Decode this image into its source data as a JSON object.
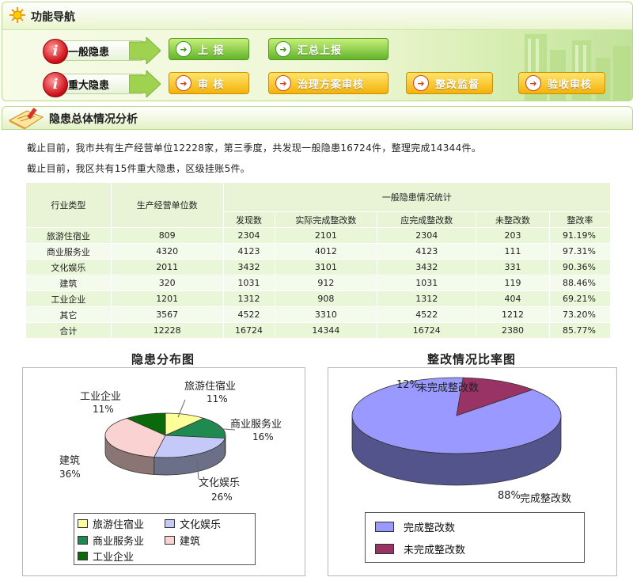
{
  "nav": {
    "title": "功能导航",
    "rows": [
      {
        "label": "一般隐患",
        "buttons": [
          "上 报",
          "汇总上报"
        ]
      },
      {
        "label": "重大隐患",
        "buttons": [
          "审 核",
          "治理方案审核",
          "整改监督",
          "验收审核"
        ]
      }
    ],
    "colors": {
      "green_button": "#62b42b",
      "orange_button": "#f3b20c",
      "info_icon": "#d0121b"
    }
  },
  "analysis": {
    "title": "隐患总体情况分析",
    "summary_1": "截止目前，我市共有生产经营单位12228家，第三季度，共发现一般隐患16724件，整理完成14344件。",
    "summary_2": "截止目前，我区共有15件重大隐患，区级挂账5件。"
  },
  "table": {
    "header_industry": "行业类型",
    "header_units": "生产经营单位数",
    "header_group": "一般隐患情况统计",
    "sub_headers": [
      "发现数",
      "实际完成整改数",
      "应完成整改数",
      "未整改数",
      "整改率"
    ],
    "rows": [
      [
        "旅游住宿业",
        "809",
        "2304",
        "2101",
        "2304",
        "203",
        "91.19%"
      ],
      [
        "商业服务业",
        "4320",
        "4123",
        "4012",
        "4123",
        "111",
        "97.31%"
      ],
      [
        "文化娱乐",
        "2011",
        "3432",
        "3101",
        "3432",
        "331",
        "90.36%"
      ],
      [
        "建筑",
        "320",
        "1031",
        "912",
        "1031",
        "119",
        "88.46%"
      ],
      [
        "工业企业",
        "1201",
        "1312",
        "908",
        "1312",
        "404",
        "69.21%"
      ],
      [
        "其它",
        "3567",
        "4522",
        "3310",
        "4522",
        "1212",
        "73.20%"
      ],
      [
        "合计",
        "12228",
        "16724",
        "14344",
        "16724",
        "2380",
        "85.77%"
      ]
    ]
  },
  "chart_data": [
    {
      "type": "pie",
      "title": "隐患分布图",
      "slices": [
        {
          "label": "旅游住宿业",
          "value": 11,
          "pct_label": "11%",
          "color": "#ffff99"
        },
        {
          "label": "商业服务业",
          "value": 16,
          "pct_label": "16%",
          "color": "#1f8a50"
        },
        {
          "label": "文化娱乐",
          "value": 26,
          "pct_label": "26%",
          "color": "#c4c9f7"
        },
        {
          "label": "建筑",
          "value": 36,
          "pct_label": "36%",
          "color": "#fbd2d2"
        },
        {
          "label": "工业企业",
          "value": 11,
          "pct_label": "11%",
          "color": "#0a6a0a"
        }
      ],
      "legend": "bottom"
    },
    {
      "type": "pie",
      "title": "整改情况比率图",
      "slices": [
        {
          "label": "完成整改数",
          "value": 88,
          "pct_label": "88%",
          "color": "#9999ff"
        },
        {
          "label": "未完成整改数",
          "value": 12,
          "pct_label": "12%",
          "color": "#993366"
        }
      ],
      "legend": "bottom"
    }
  ]
}
